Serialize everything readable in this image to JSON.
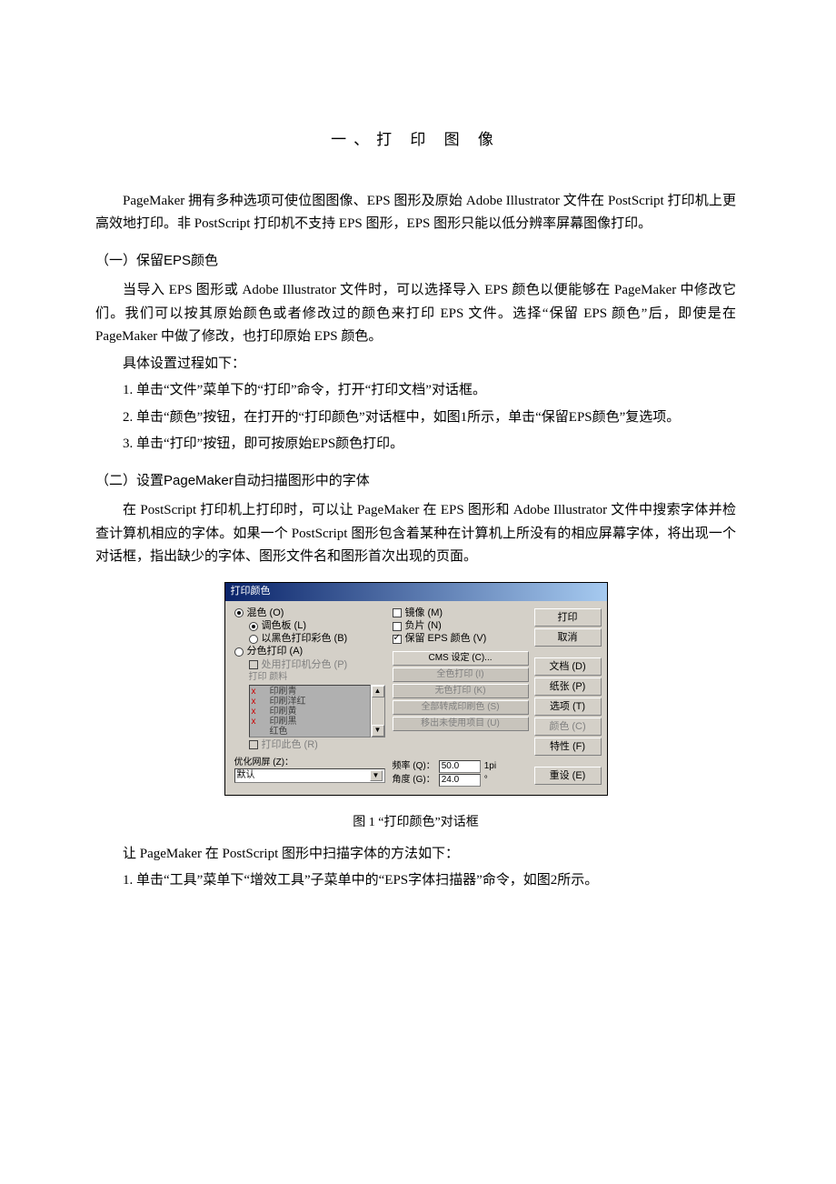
{
  "doc": {
    "title": "一、打  印  图  像",
    "intro": "PageMaker 拥有多种选项可使位图图像、EPS 图形及原始 Adobe Illustrator 文件在 PostScript 打印机上更高效地打印。非 PostScript 打印机不支持 EPS 图形，EPS 图形只能以低分辨率屏幕图像打印。",
    "s1": {
      "heading": "（一）保留EPS颜色",
      "p1": "当导入 EPS 图形或 Adobe Illustrator 文件时，可以选择导入 EPS 颜色以便能够在 PageMaker 中修改它们。我们可以按其原始颜色或者修改过的颜色来打印 EPS 文件。选择“保留 EPS 颜色”后，即使是在 PageMaker 中做了修改，也打印原始 EPS 颜色。",
      "p2": "具体设置过程如下：",
      "step1": "1. 单击“文件”菜单下的“打印”命令，打开“打印文档”对话框。",
      "step2": "2. 单击“颜色”按钮，在打开的“打印颜色”对话框中，如图1所示，单击“保留EPS颜色”复选项。",
      "step3": "3. 单击“打印”按钮，即可按原始EPS颜色打印。"
    },
    "s2": {
      "heading": "（二）设置PageMaker自动扫描图形中的字体",
      "p1": "在 PostScript 打印机上打印时，可以让 PageMaker 在 EPS 图形和 Adobe Illustrator 文件中搜索字体并检查计算机相应的字体。如果一个 PostScript 图形包含着某种在计算机上所没有的相应屏幕字体，将出现一个对话框，指出缺少的字体、图形文件名和图形首次出现的页面。",
      "caption": "图 1   “打印颜色”对话框",
      "p2": "让 PageMaker 在 PostScript 图形中扫描字体的方法如下：",
      "step1": "1. 单击“工具”菜单下“增效工具”子菜单中的“EPS字体扫描器”命令，如图2所示。"
    }
  },
  "dlg": {
    "title": "打印颜色",
    "composite": "混色 (O)",
    "palette": "调色板 (L)",
    "bw": "以黑色打印彩色 (B)",
    "sep": "分色打印 (A)",
    "usePrinter": "处用打印机分色 (P)",
    "printInks": "打印    颜料",
    "inks": [
      "印刷青",
      "印刷洋红",
      "印刷黄",
      "印刷黑",
      "红色"
    ],
    "printAll": "打印此色 (R)",
    "screenLabel": "优化网屏 (Z)：",
    "screenVal": "默认",
    "mirror": "镜像 (M)",
    "negative": "负片 (N)",
    "keepEPS": "保留 EPS 颜色 (V)",
    "cms": "CMS 设定 (C)...",
    "allInk": "全色打印 (I)",
    "noInk": "无色打印 (K)",
    "spot": "全部转成印刷色 (S)",
    "removeUnused": "移出未使用项目 (U)",
    "freqLabel": "频率 (Q)：",
    "freqVal": "50.0",
    "freqUnit": "1pi",
    "angleLabel": "角度 (G)：",
    "angleVal": "24.0",
    "angleUnit": "°",
    "btnPrint": "打印",
    "btnCancel": "取消",
    "btnDoc": "文档 (D)",
    "btnPaper": "纸张 (P)",
    "btnOptions": "选项 (T)",
    "btnColor": "颜色 (C)",
    "btnFeatures": "特性 (F)",
    "btnReset": "重设 (E)"
  }
}
